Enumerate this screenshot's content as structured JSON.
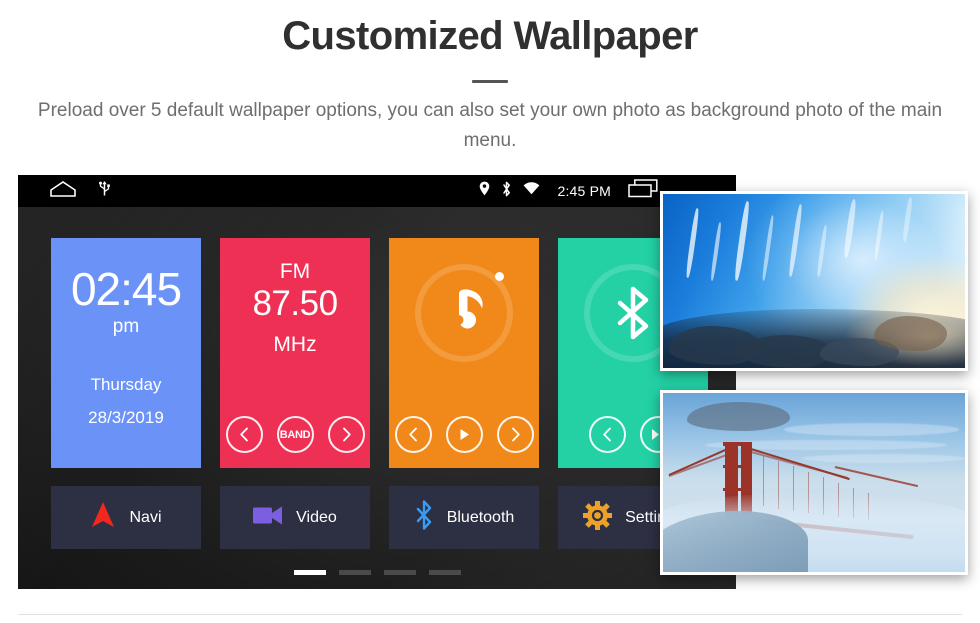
{
  "header": {
    "title": "Customized Wallpaper",
    "subtitle": "Preload over 5 default wallpaper options, you can also set your own photo as background photo of the main menu."
  },
  "device": {
    "statusbar": {
      "home_icon": "home-icon",
      "usb_icon": "usb-icon",
      "location_icon": "location-pin-icon",
      "bluetooth_icon": "bluetooth-icon",
      "wifi_icon": "wifi-icon",
      "time": "2:45 PM",
      "recents_icon": "recents-icon"
    },
    "tiles": [
      {
        "name": "clock",
        "color": "#6b93f7",
        "time": "02:45",
        "meridiem": "pm",
        "weekday": "Thursday",
        "date": "28/3/2019"
      },
      {
        "name": "radio",
        "color": "#ef3055",
        "band": "FM",
        "frequency": "87.50",
        "unit": "MHz",
        "controls": [
          "prev",
          "BAND",
          "next"
        ],
        "band_label": "BAND"
      },
      {
        "name": "music",
        "color": "#f0891a",
        "glyph": "music-note-icon",
        "controls": [
          "prev",
          "play",
          "next"
        ]
      },
      {
        "name": "bluetooth",
        "color": "#23d1a5",
        "glyph": "bluetooth-icon",
        "controls": [
          "prev",
          "play-pause"
        ]
      }
    ],
    "shortcuts": [
      {
        "label": "Navi",
        "icon": "navigation-arrow-icon",
        "color": "#f0281e"
      },
      {
        "label": "Video",
        "icon": "video-camera-icon",
        "color": "#7b5fe0"
      },
      {
        "label": "Bluetooth",
        "icon": "bluetooth-icon",
        "color": "#3a9bf2"
      },
      {
        "label": "Settings",
        "icon": "gear-icon",
        "color": "#eda127"
      }
    ],
    "page_dots": {
      "count": 4,
      "active_index": 0
    }
  },
  "wallpapers": [
    {
      "name": "ice-cave-wallpaper"
    },
    {
      "name": "golden-gate-bridge-wallpaper"
    }
  ]
}
